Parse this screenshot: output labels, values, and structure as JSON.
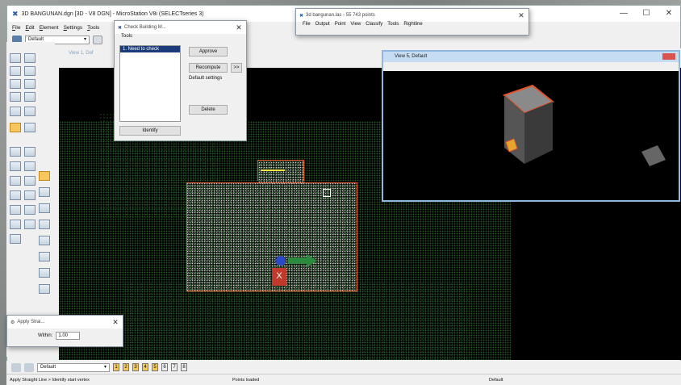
{
  "main_window": {
    "title": "3D BANGUNAN.dgn [3D - V8 DGN] - MicroStation V8i (SELECTseries 3)",
    "menu": [
      "File",
      "Edit",
      "Element",
      "Settings",
      "Tools"
    ],
    "level_combo": "Default",
    "minimize": "—",
    "close": "✕"
  },
  "las_window": {
    "title": "3d bangunan.las - 55 743 points",
    "menu": [
      "File",
      "Output",
      "Point",
      "View",
      "Classify",
      "Tools",
      "Rightline"
    ]
  },
  "check_dialog": {
    "title": "Check Building M...",
    "menu": "Tools",
    "list_item": "1.  Need to check",
    "approve": "Approve",
    "recompute": "Recompute",
    "more": ">>",
    "settings_text": "Default settings",
    "delete": "Delete",
    "identify": "Identify"
  },
  "view1": {
    "title": "View 1, Def"
  },
  "view5": {
    "title": "View 5, Default"
  },
  "apply_dialog": {
    "title": "Apply Strai...",
    "within_label": "Within:",
    "within_value": "1.00"
  },
  "bottom_bar": {
    "level": "Default",
    "view_buttons": [
      "1",
      "2",
      "3",
      "4",
      "5",
      "6",
      "7",
      "8"
    ]
  },
  "status": {
    "prompt": "Apply Straight Line > Identify start vertex",
    "message": "Points loaded",
    "level": "Default"
  },
  "colors": {
    "boundary": "#e5542c",
    "highlight": "#f1e64a",
    "accent_green": "#2b8a3e"
  }
}
